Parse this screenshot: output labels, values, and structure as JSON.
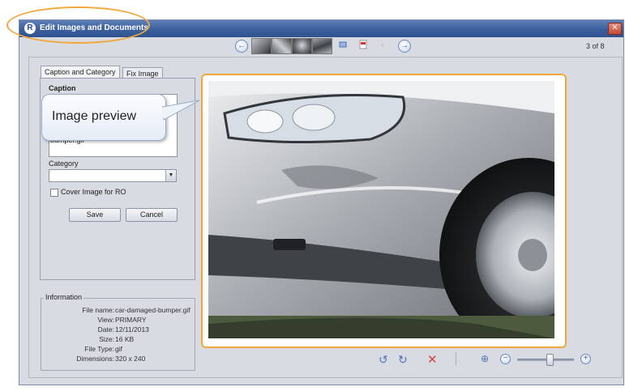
{
  "window": {
    "title": "Edit Images and Documents",
    "logo_letter": "R",
    "close_glyph": "✕"
  },
  "toolbar": {
    "page_counter": "3 of 8"
  },
  "tabs": [
    {
      "label": "Caption and Category"
    },
    {
      "label": "Fix Image"
    }
  ],
  "form": {
    "caption_label": "Caption",
    "caption_value_visible": "bumper.gif",
    "category_label": "Category",
    "category_value": "",
    "cover_image_label": "Cover Image for RO",
    "cover_image_checked": false,
    "save_label": "Save",
    "cancel_label": "Cancel"
  },
  "information": {
    "legend": "Information",
    "rows": [
      {
        "label": "File name:",
        "value": "car-damaged-bumper.gif"
      },
      {
        "label": "View:",
        "value": "PRIMARY"
      },
      {
        "label": "Date:",
        "value": "12/11/2013"
      },
      {
        "label": "Size:",
        "value": "16 KB"
      },
      {
        "label": "File Type:",
        "value": "gif"
      },
      {
        "label": "Dimensions:",
        "value": "320 x 240"
      }
    ]
  },
  "callout": {
    "text": "Image preview"
  },
  "colors": {
    "highlight": "#f0a83c",
    "title_bar": "#3b5f9e",
    "window_bg": "#d8dbe2"
  }
}
